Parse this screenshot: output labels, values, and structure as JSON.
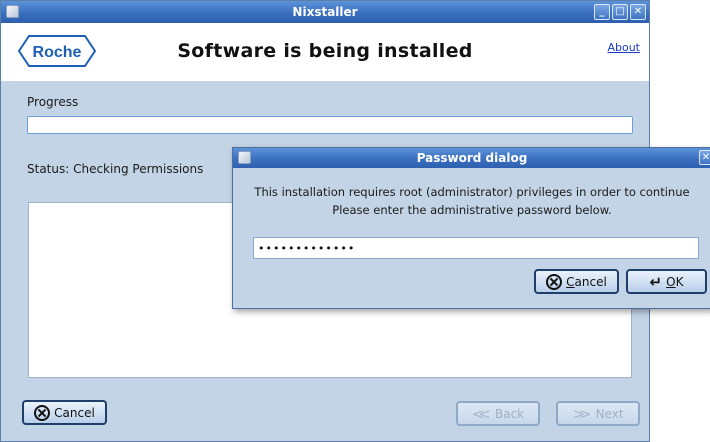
{
  "main_window": {
    "title": "Nixstaller",
    "wm_buttons": {
      "minimize": "_",
      "maximize": "□",
      "close": "✕"
    },
    "logo_text": "Roche",
    "header_title": "Software is being installed",
    "about_link": "About",
    "progress_label": "Progress",
    "progress_value": 0,
    "status_text": "Status: Checking Permissions",
    "cancel_button": "Cancel",
    "back_button": "Back",
    "next_button": "Next"
  },
  "password_dialog": {
    "title": "Password dialog",
    "message_line1": "This installation requires root (administrator) privileges in order to continue",
    "message_line2": "Please enter the administrative password below.",
    "password_value": "•••••••••••••",
    "cancel_label_underlined": "C",
    "cancel_label_rest": "ancel",
    "ok_label_underlined": "O",
    "ok_label_rest": "K"
  },
  "icons": {
    "app_icon": "installer-app-icon",
    "cancel_icon": "circle-x-icon",
    "back_icon": "double-chevron-left-icon",
    "next_icon": "double-chevron-right-icon",
    "ok_icon": "enter-arrow-icon"
  },
  "colors": {
    "titlebar": "#3a6fc0",
    "window_bg": "#c3d4e6",
    "link": "#1a3cc7"
  }
}
